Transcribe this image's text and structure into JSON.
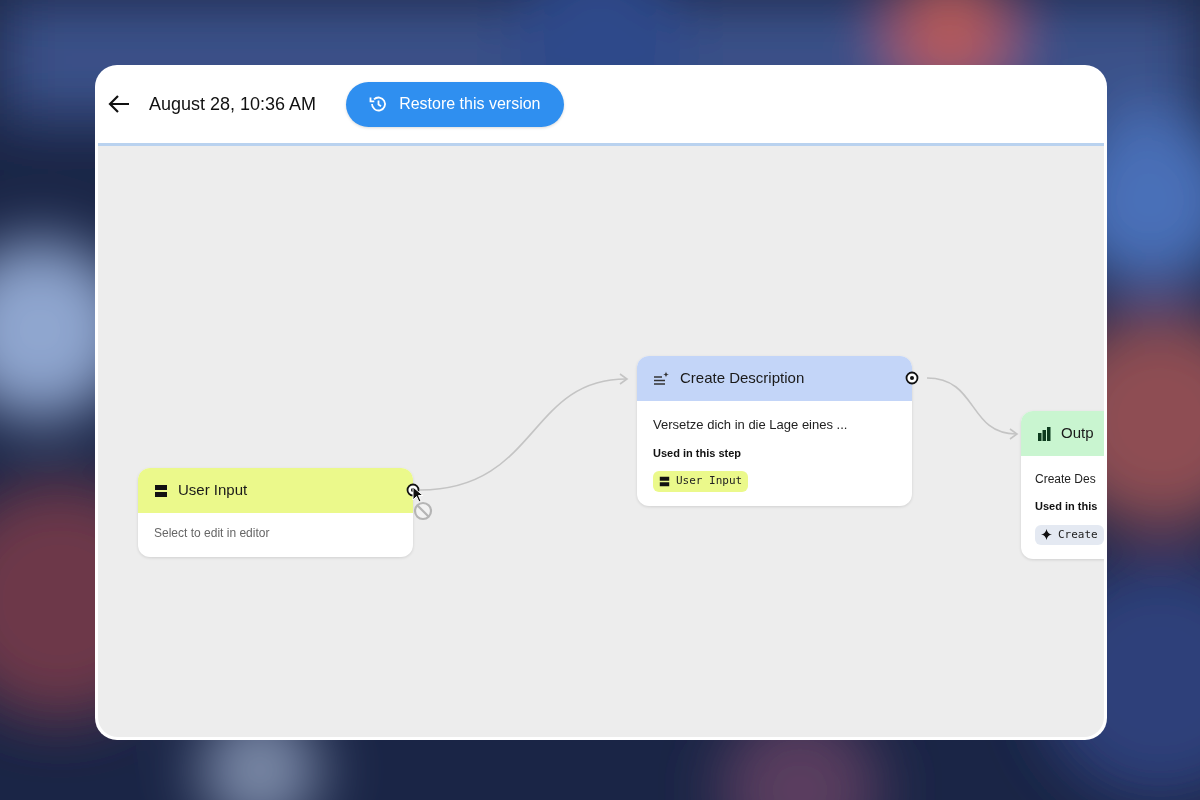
{
  "header": {
    "timestamp": "August 28, 10:36 AM",
    "restore_button": "Restore this version"
  },
  "nodes": [
    {
      "kind": "input",
      "title": "User Input",
      "description": "Select to edit in editor"
    },
    {
      "kind": "generate",
      "title": "Create Description",
      "description": "Versetze dich in die Lage eines ...",
      "used_label": "Used in this step",
      "chips": [
        {
          "kind": "input",
          "label": "User Input"
        }
      ]
    },
    {
      "kind": "output",
      "title": "Outp",
      "description": "Create Des",
      "used_label": "Used in this",
      "chips": [
        {
          "kind": "generate",
          "label": "Create"
        }
      ]
    }
  ]
}
